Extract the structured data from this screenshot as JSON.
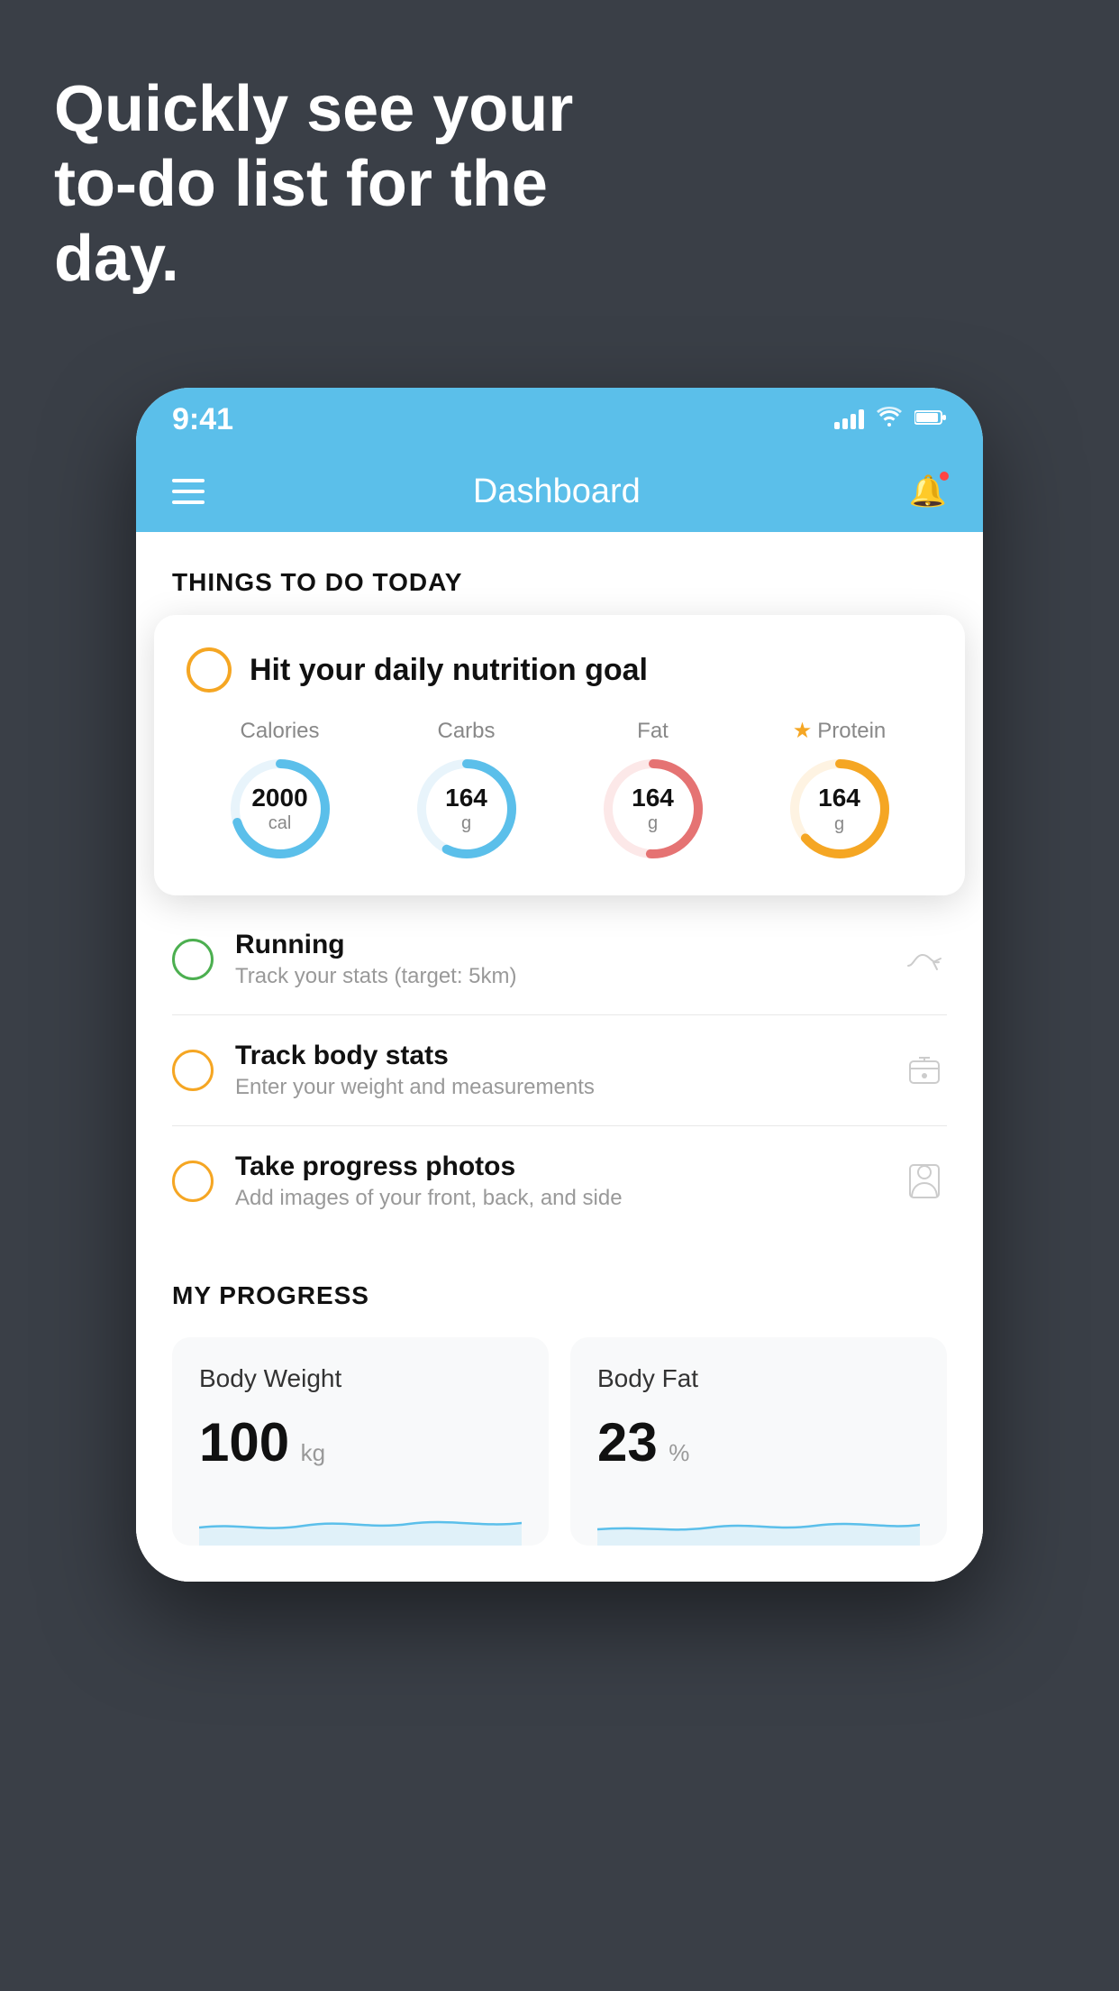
{
  "hero": {
    "title": "Quickly see your to-do list for the day."
  },
  "status_bar": {
    "time": "9:41"
  },
  "header": {
    "title": "Dashboard"
  },
  "things_to_do": {
    "section_title": "THINGS TO DO TODAY",
    "nutrition_card": {
      "check_label": "Hit your daily nutrition goal",
      "items": [
        {
          "label": "Calories",
          "value": "2000",
          "unit": "cal",
          "color": "#5bbfea",
          "star": false
        },
        {
          "label": "Carbs",
          "value": "164",
          "unit": "g",
          "color": "#5bbfea",
          "star": false
        },
        {
          "label": "Fat",
          "value": "164",
          "unit": "g",
          "color": "#e57373",
          "star": false
        },
        {
          "label": "Protein",
          "value": "164",
          "unit": "g",
          "color": "#f5a623",
          "star": true
        }
      ]
    },
    "todo_items": [
      {
        "title": "Running",
        "subtitle": "Track your stats (target: 5km)",
        "circle_color": "green",
        "icon": "shoe"
      },
      {
        "title": "Track body stats",
        "subtitle": "Enter your weight and measurements",
        "circle_color": "yellow",
        "icon": "scale"
      },
      {
        "title": "Take progress photos",
        "subtitle": "Add images of your front, back, and side",
        "circle_color": "yellow",
        "icon": "person"
      }
    ]
  },
  "progress": {
    "section_title": "MY PROGRESS",
    "cards": [
      {
        "title": "Body Weight",
        "value": "100",
        "unit": "kg"
      },
      {
        "title": "Body Fat",
        "value": "23",
        "unit": "%"
      }
    ]
  }
}
